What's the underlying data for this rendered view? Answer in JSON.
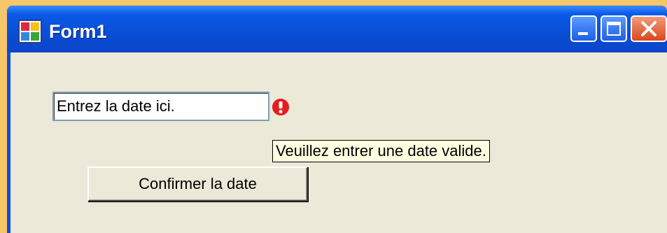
{
  "window": {
    "title": "Form1",
    "icon": "form-app-icon",
    "controls": {
      "minimize": "minimize-icon",
      "maximize": "maximize-icon",
      "close": "close-icon"
    }
  },
  "form": {
    "date_input": {
      "value": "Entrez la date ici."
    },
    "error_icon": "error-exclamation-icon",
    "error_tooltip": "Veuillez entrer une date valide.",
    "confirm_button": "Confirmer la date"
  },
  "colors": {
    "titlebar": "#0a4fd8",
    "client_background": "#ece9d8",
    "error": "#e41e1e",
    "tooltip_background": "#ffffe1",
    "close_button": "#d9481c"
  }
}
